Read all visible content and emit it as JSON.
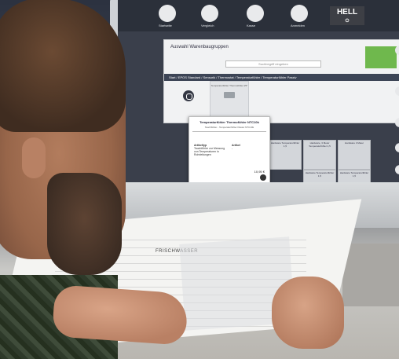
{
  "top_tiles": [
    "Startseite",
    "Vergleich",
    "Kasse",
    "Anmelden"
  ],
  "brand": {
    "name": "HELL",
    "sub": "⏻"
  },
  "dialog": {
    "title": "Auswahl Warenbaugruppen",
    "search_placeholder": "Suchbegriff eingeben",
    "breadcrumb": "Start / EPOS Standard / Sensorik / Thermostat / Temperaturfühler / Temperaturfühler Passiv"
  },
  "card": {
    "title": "Temperaturfühler Thermofühler 25°",
    "price": "11,55 €"
  },
  "popup": {
    "title": "Temperaturfühler Thermofühler NTC10k",
    "subtitle": "Tauchfühler - Temperaturfühler Passiv NTC10k",
    "left_heading": "Artikeltyp",
    "left_text": "Tauchfühler zur Messung von Temperaturen in Rohrleitungen",
    "right_heading": "Artikel",
    "right_text": "-",
    "price": "10,95 €"
  },
  "grid_cards": [
    {
      "label": "Hardware Temperaturfühler 1,5"
    },
    {
      "label": "Hardware, 3 Meter Temperaturfühler 1,5"
    },
    {
      "label": "Hardware 3 Meter"
    },
    {
      "label": "Hardware Temperaturfühler 1,5"
    },
    {
      "label": "Hardware Temperaturfühler 1,5"
    }
  ],
  "plan_title": "FRISCHWASSER"
}
